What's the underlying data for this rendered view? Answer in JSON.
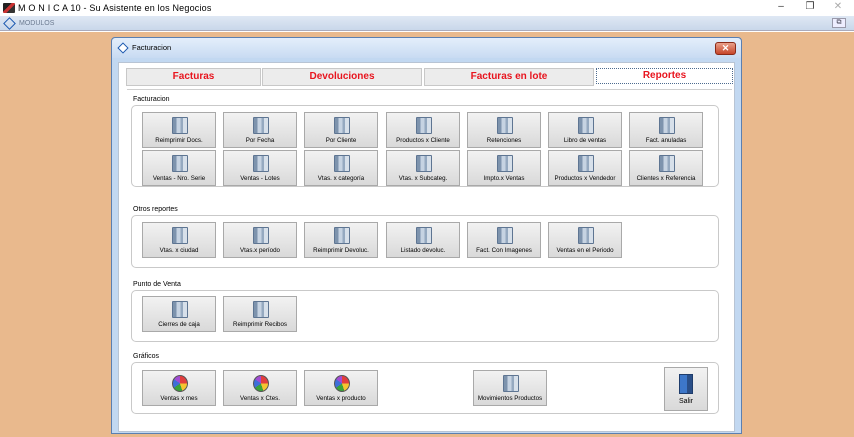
{
  "app": {
    "title": "M O N I C A  10 - Su Asistente en los Negocios",
    "controls": {
      "minimize": "–",
      "restore": "❐",
      "close": "✕"
    }
  },
  "mdi": {
    "title": "MODULOS",
    "restore": "⧉"
  },
  "dialog": {
    "title": "Facturacion",
    "close": "✕",
    "tabs": [
      {
        "label": "Facturas"
      },
      {
        "label": "Devoluciones"
      },
      {
        "label": "Facturas en lote"
      },
      {
        "label": "Reportes"
      }
    ]
  },
  "groups": {
    "facturacion": {
      "label": "Facturacion",
      "buttons": [
        "Reimprimir Docs.",
        "Por Fecha",
        "Por Cliente",
        "Productos x Cliente",
        "Retenciones",
        "Libro de ventas",
        "Fact. anuladas",
        "Ventas - Nro. Serie",
        "Ventas - Lotes",
        "Vtas. x categoría",
        "Vtas. x Subcateg.",
        "Impto.x Ventas",
        "Productos x Vendedor",
        "Clientes x Referencia"
      ]
    },
    "otros": {
      "label": "Otros reportes",
      "buttons": [
        "Vtas. x ciudad",
        "Vtas.x período",
        "Reimprimir Devoluc.",
        "Listado devoluc.",
        "Fact. Con Imagenes",
        "Ventas en el Periodo"
      ]
    },
    "punto_venta": {
      "label": "Punto de Venta",
      "buttons": [
        "Cierres de caja",
        "Reimprimir Recibos"
      ]
    },
    "graficos": {
      "label": "Gráficos",
      "buttons": [
        "Ventas x mes",
        "Ventas x Ctes.",
        "Ventas x producto"
      ],
      "movimientos": "Movimientos Productos",
      "salir": "Salir"
    }
  }
}
